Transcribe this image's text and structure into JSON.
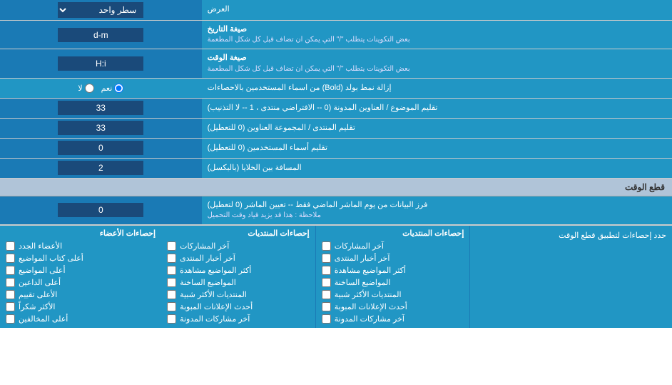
{
  "rows": [
    {
      "id": "display-mode",
      "label": "العرض",
      "input_type": "select",
      "value": "سطر واحد",
      "width_label": "70%",
      "width_input": "30%"
    },
    {
      "id": "date-format",
      "label": "صيغة التاريخ\nبعض التكوينات يتطلب \"/\" التي يمكن ان تضاف قبل كل شكل المطعمة",
      "input_type": "text",
      "value": "d-m",
      "width_label": "70%",
      "width_input": "30%"
    },
    {
      "id": "time-format",
      "label": "صيغة الوقت\nبعض التكوينات يتطلب \"/\" التي يمكن ان تضاف قبل كل شكل المطعمة",
      "input_type": "text",
      "value": "H:i",
      "width_label": "70%",
      "width_input": "30%"
    },
    {
      "id": "bold-remove",
      "label": "إزالة نمط بولد (Bold) من اسماء المستخدمين بالاحصاءات",
      "input_type": "radio",
      "options": [
        "نعم",
        "لا"
      ],
      "selected": "نعم",
      "width_label": "70%",
      "width_input": "30%"
    },
    {
      "id": "topic-title",
      "label": "تقليم الموضوع / العناوين المدونة (0 -- الافتراضي منتدى ، 1 -- لا التذنيب)",
      "input_type": "text",
      "value": "33",
      "width_label": "70%",
      "width_input": "30%"
    },
    {
      "id": "forum-group",
      "label": "تقليم المنتدى / المجموعة العناوين (0 للتعطيل)",
      "input_type": "text",
      "value": "33",
      "width_label": "70%",
      "width_input": "30%"
    },
    {
      "id": "user-names",
      "label": "تقليم أسماء المستخدمين (0 للتعطيل)",
      "input_type": "text",
      "value": "0",
      "width_label": "70%",
      "width_input": "30%"
    },
    {
      "id": "cell-space",
      "label": "المسافة بين الخلايا (بالبكسل)",
      "input_type": "text",
      "value": "2",
      "width_label": "70%",
      "width_input": "30%"
    }
  ],
  "section_cutoff": {
    "title": "قطع الوقت",
    "row": {
      "id": "cutoff-days",
      "label": "فرز البيانات من يوم الماشر الماضي فقط -- تعيين الماشر (0 لتعطيل)\nملاحظة : هذا قد يزيد قياد وقت التحميل",
      "input_type": "text",
      "value": "0"
    }
  },
  "checkboxes_label": "حدد إحصاءات لتطبيق قطع الوقت",
  "checkbox_columns": [
    {
      "id": "col1",
      "items": [
        {
          "id": "cb1",
          "label": "آخر المشاركات"
        },
        {
          "id": "cb2",
          "label": "آخر أخبار المنتدى"
        },
        {
          "id": "cb3",
          "label": "أكثر المواضيع مشاهدة"
        },
        {
          "id": "cb4",
          "label": "المواضيع الساخنة"
        },
        {
          "id": "cb5",
          "label": "المنتديات الأكثر شبية"
        },
        {
          "id": "cb6",
          "label": "أحدث الإعلانات المبوبة"
        },
        {
          "id": "cb7",
          "label": "آخر مشاركات المدونة"
        }
      ]
    },
    {
      "id": "col2",
      "items": [
        {
          "id": "cb8",
          "label": "إحصاءات المنتديات"
        },
        {
          "id": "cb9",
          "label": "آخر المشاركات"
        },
        {
          "id": "cb10",
          "label": "آخر أخبار المنتدى"
        },
        {
          "id": "cb11",
          "label": "أكثر المواضيع مشاهدة"
        },
        {
          "id": "cb12",
          "label": "المواضيع الساخنة"
        },
        {
          "id": "cb13",
          "label": "المنتديات الأكثر شبية"
        },
        {
          "id": "cb14",
          "label": "أحدث الإعلانات المبوبة"
        }
      ]
    },
    {
      "id": "col3",
      "items": [
        {
          "id": "cb15",
          "label": "إحصاءات الأعضاء"
        },
        {
          "id": "cb16",
          "label": "الأعضاء الجدد"
        },
        {
          "id": "cb17",
          "label": "أعلى كتاب المواضيع"
        },
        {
          "id": "cb18",
          "label": "أعلى المواضيع"
        },
        {
          "id": "cb19",
          "label": "أعلى الداعين"
        },
        {
          "id": "cb20",
          "label": "الأعلى تقييم"
        },
        {
          "id": "cb21",
          "label": "الأكثر شكراً"
        },
        {
          "id": "cb22",
          "label": "أعلى المخالفين"
        }
      ]
    }
  ],
  "labels": {
    "display_mode": "سطر واحد",
    "yes": "نعم",
    "no": "لا"
  }
}
